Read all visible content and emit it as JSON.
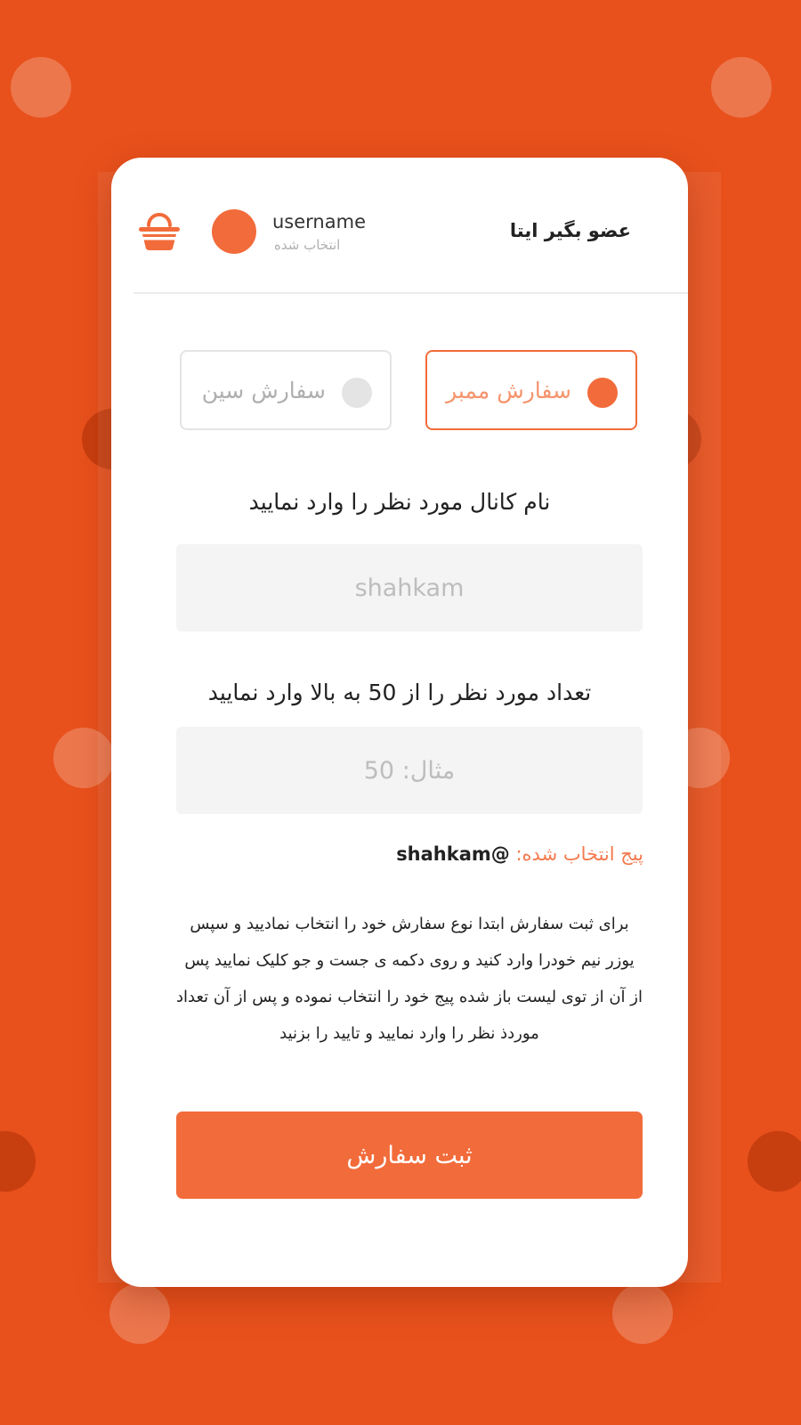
{
  "header": {
    "app_title": "عضو بگیر ایتا",
    "username": "username",
    "user_status": "انتخاب شده",
    "logo_icon": "basket-icon"
  },
  "order_types": {
    "member_label": "سفارش ممبر",
    "view_label": "سفارش سین",
    "selected": "member"
  },
  "form": {
    "channel_label": "نام کانال مورد نظر را وارد نمایید",
    "channel_placeholder": "shahkam",
    "count_label": "تعداد مورد نظر را از 50 به بالا وارد نمایید",
    "count_placeholder": "مثال: 50"
  },
  "selected_page": {
    "label": "پیج انتخاب شده:",
    "value": "@shahkam"
  },
  "instructions": "برای ثبت سفارش ابتدا نوع سفارش خود را انتخاب نمادیید و سپس یوزر نیم خودرا وارد کنید و روی دکمه ی جست و جو کلیک نمایید پس از آن از توی لیست باز شده پیج خود را انتخاب نموده و پس از آن تعداد موردذ نظر را وارد نمایید و تایید را بزنید",
  "submit_label": "ثبت سفارش",
  "colors": {
    "background": "#E8511C",
    "accent": "#F26B3A",
    "card": "#FFFFFF",
    "input_bg": "#F4F4F4"
  }
}
